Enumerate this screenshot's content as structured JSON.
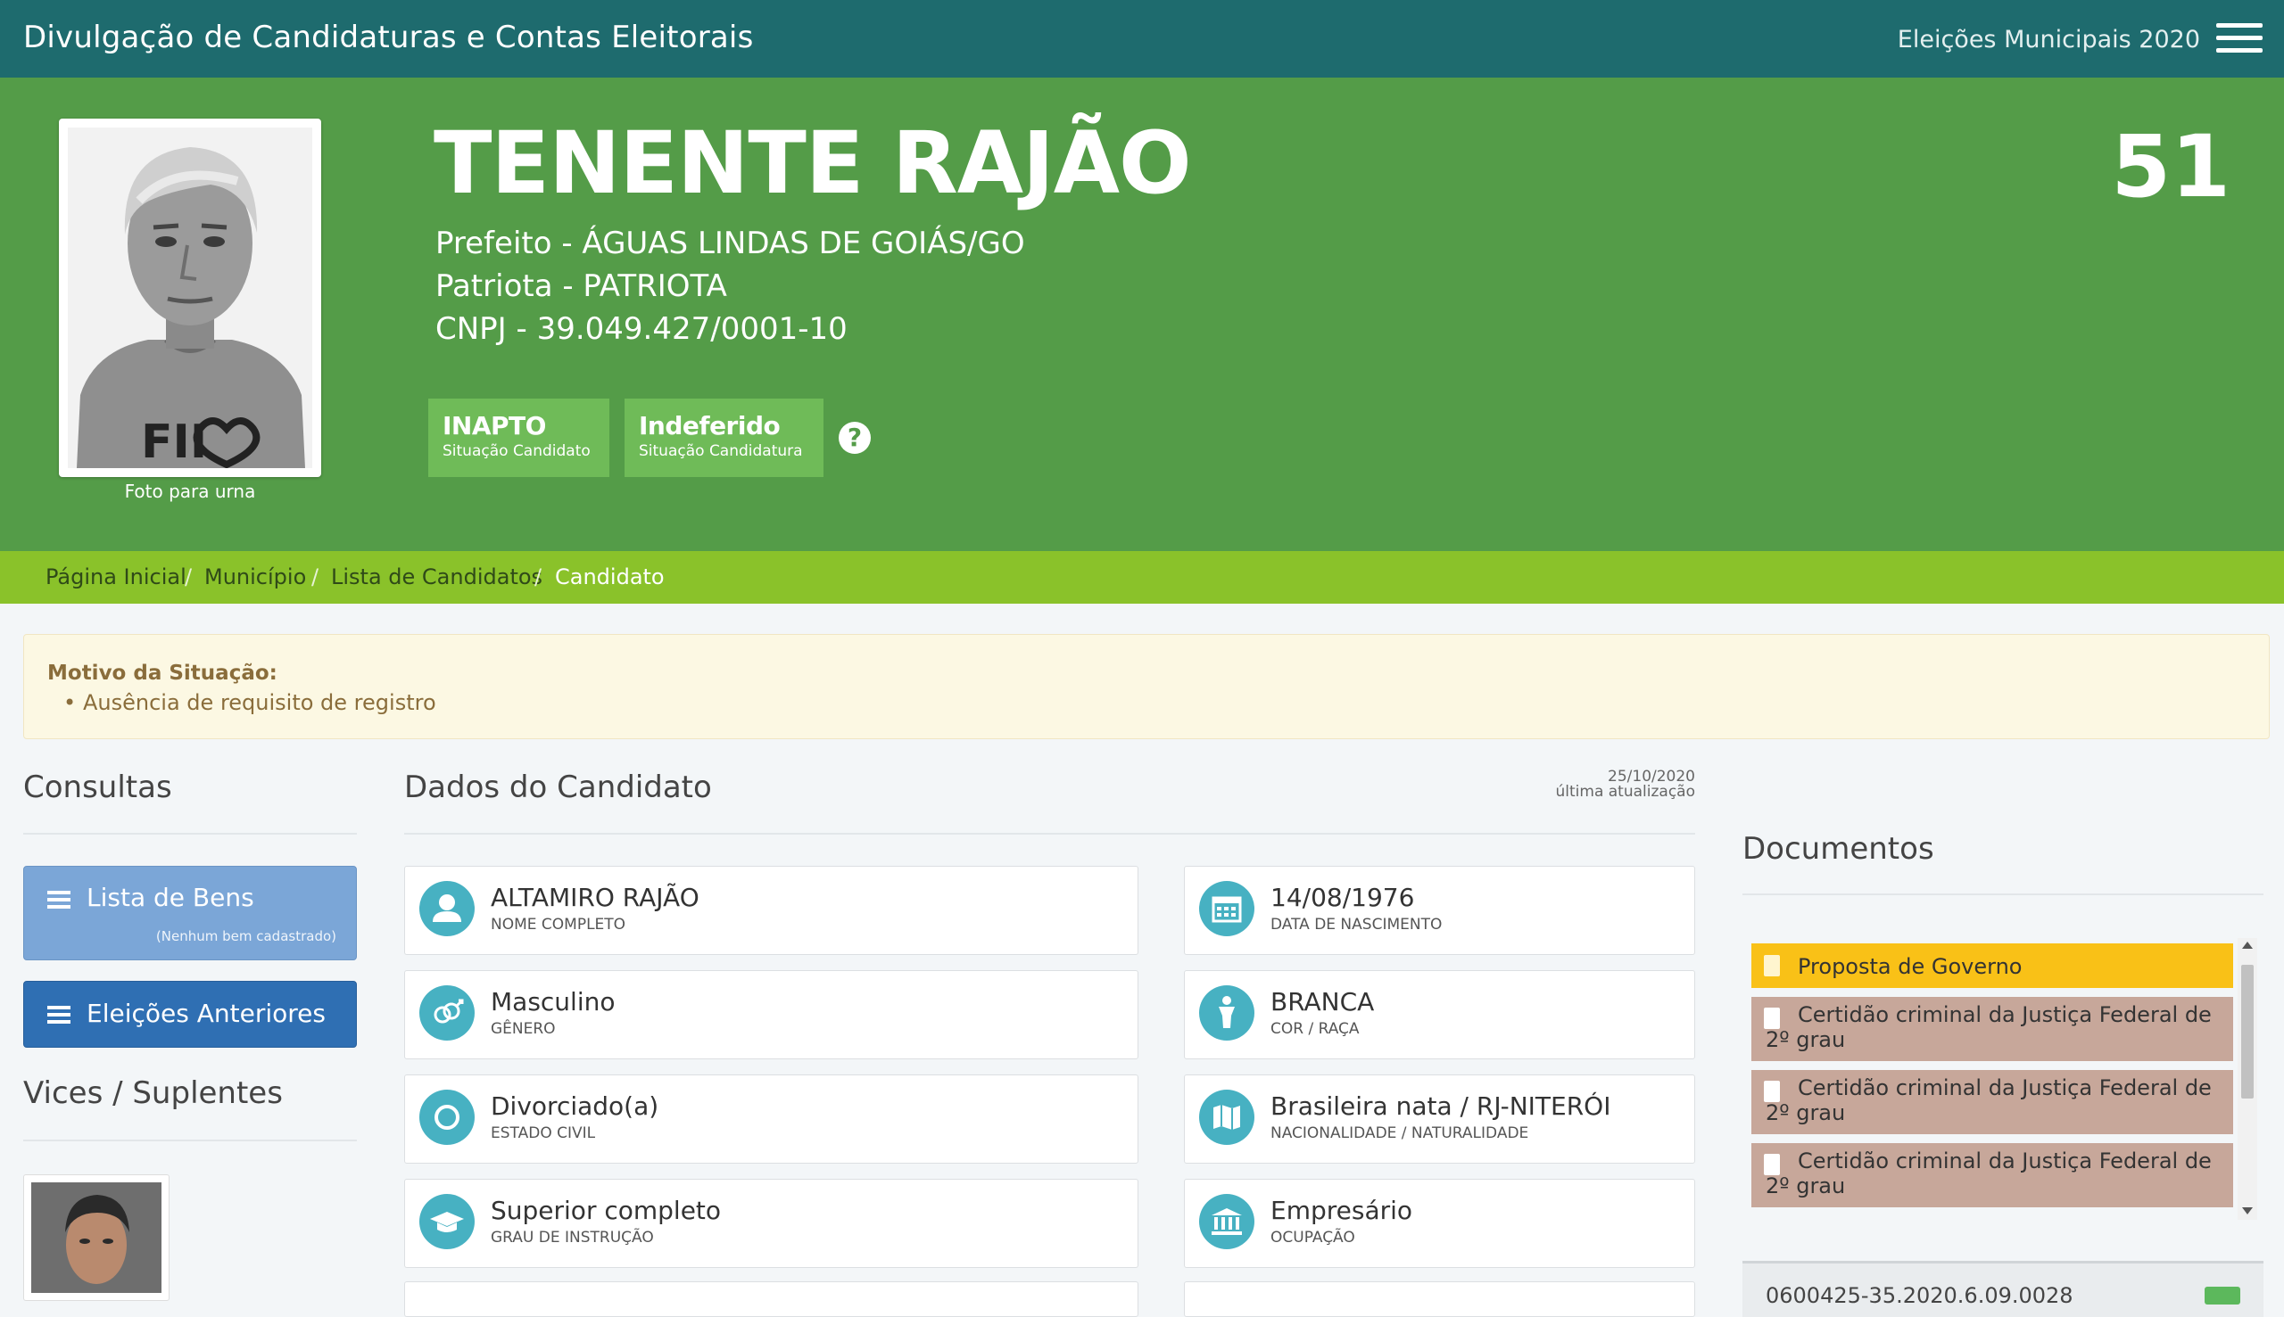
{
  "header": {
    "app_title": "Divulgação de Candidaturas e Contas Eleitorais",
    "election_name": "Eleições Municipais 2020",
    "menu_icon": "hamburger-menu-icon",
    "background": "#1e6b6e"
  },
  "candidate": {
    "name": "TENENTE RAJÃO",
    "office_line": "Prefeito - ÁGUAS LINDAS DE GOIÁS/GO",
    "party_line": "Patriota - PATRIOTA",
    "cnpj_line": "CNPJ - 39.049.427/0001-10",
    "number": "51",
    "photo_caption": "Foto para urna",
    "hero_color": "#549c48",
    "status": [
      {
        "value": "INAPTO",
        "label": "Situação Candidato"
      },
      {
        "value": "Indeferido",
        "label": "Situação Candidatura"
      }
    ],
    "help_icon": "question-circle-icon"
  },
  "breadcrumb": {
    "items": [
      "Página Inicial",
      "Município",
      "Lista de Candidatos",
      "Candidato"
    ],
    "separator": "/"
  },
  "alert": {
    "title": "Motivo da Situação:",
    "items": [
      "Ausência de requisito de registro"
    ]
  },
  "consultas": {
    "title": "Consultas",
    "lista_bens_label": "Lista de Bens",
    "lista_bens_note": "(Nenhum bem cadastrado)",
    "eleicoes_anteriores_label": "Eleições Anteriores",
    "vices_title": "Vices / Suplentes"
  },
  "dados": {
    "title": "Dados do Candidato",
    "update_date": "25/10/2020",
    "update_label": "última atualização",
    "fields": [
      {
        "value": "ALTAMIRO RAJÃO",
        "label": "NOME COMPLETO",
        "icon": "user-icon"
      },
      {
        "value": "14/08/1976",
        "label": "DATA DE NASCIMENTO",
        "icon": "calendar-icon"
      },
      {
        "value": "Masculino",
        "label": "GÊNERO",
        "icon": "gender-icon"
      },
      {
        "value": "BRANCA",
        "label": "COR / RAÇA",
        "icon": "person-standing-icon"
      },
      {
        "value": "Divorciado(a)",
        "label": "ESTADO CIVIL",
        "icon": "ring-icon"
      },
      {
        "value": "Brasileira nata / RJ-NITERÓI",
        "label": "NACIONALIDADE / NATURALIDADE",
        "icon": "map-icon"
      },
      {
        "value": "Superior completo",
        "label": "GRAU DE INSTRUÇÃO",
        "icon": "graduation-cap-icon"
      },
      {
        "value": "Empresário",
        "label": "OCUPAÇÃO",
        "icon": "bank-building-icon"
      }
    ],
    "icon_color": "#47b1c2"
  },
  "documentos": {
    "title": "Documentos",
    "items": [
      {
        "label": "Proposta de Governo",
        "color": "#f9c117"
      },
      {
        "label": "Certidão criminal da Justiça Federal de 2º grau",
        "color": "#c7a79a"
      },
      {
        "label": "Certidão criminal da Justiça Federal de 2º grau",
        "color": "#c7a79a"
      },
      {
        "label": "Certidão criminal da Justiça Federal de 2º grau",
        "color": "#c7a79a"
      }
    ],
    "process_number": "0600425-35.2020.6.09.0028"
  }
}
